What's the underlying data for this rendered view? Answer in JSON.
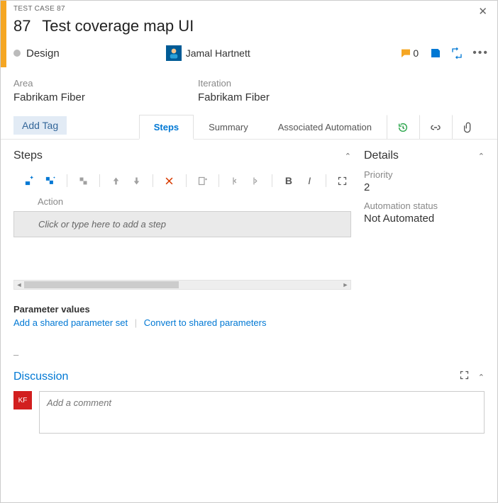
{
  "header": {
    "type_label": "TEST CASE 87",
    "id": "87",
    "title": "Test coverage map UI",
    "state": "Design",
    "assignee": "Jamal Hartnett",
    "comment_count": "0"
  },
  "fields": {
    "area_label": "Area",
    "area_value": "Fabrikam Fiber",
    "iteration_label": "Iteration",
    "iteration_value": "Fabrikam Fiber"
  },
  "tags": {
    "add_tag_label": "Add Tag"
  },
  "tabs": {
    "steps": "Steps",
    "summary": "Summary",
    "automation": "Associated Automation"
  },
  "steps": {
    "section_title": "Steps",
    "action_header": "Action",
    "placeholder": "Click or type here to add a step",
    "param_title": "Parameter values",
    "add_shared": "Add a shared parameter set",
    "convert_shared": "Convert to shared parameters"
  },
  "details": {
    "section_title": "Details",
    "priority_label": "Priority",
    "priority_value": "2",
    "automation_label": "Automation status",
    "automation_value": "Not Automated"
  },
  "discussion": {
    "section_title": "Discussion",
    "avatar_initials": "KF",
    "comment_placeholder": "Add a comment"
  }
}
